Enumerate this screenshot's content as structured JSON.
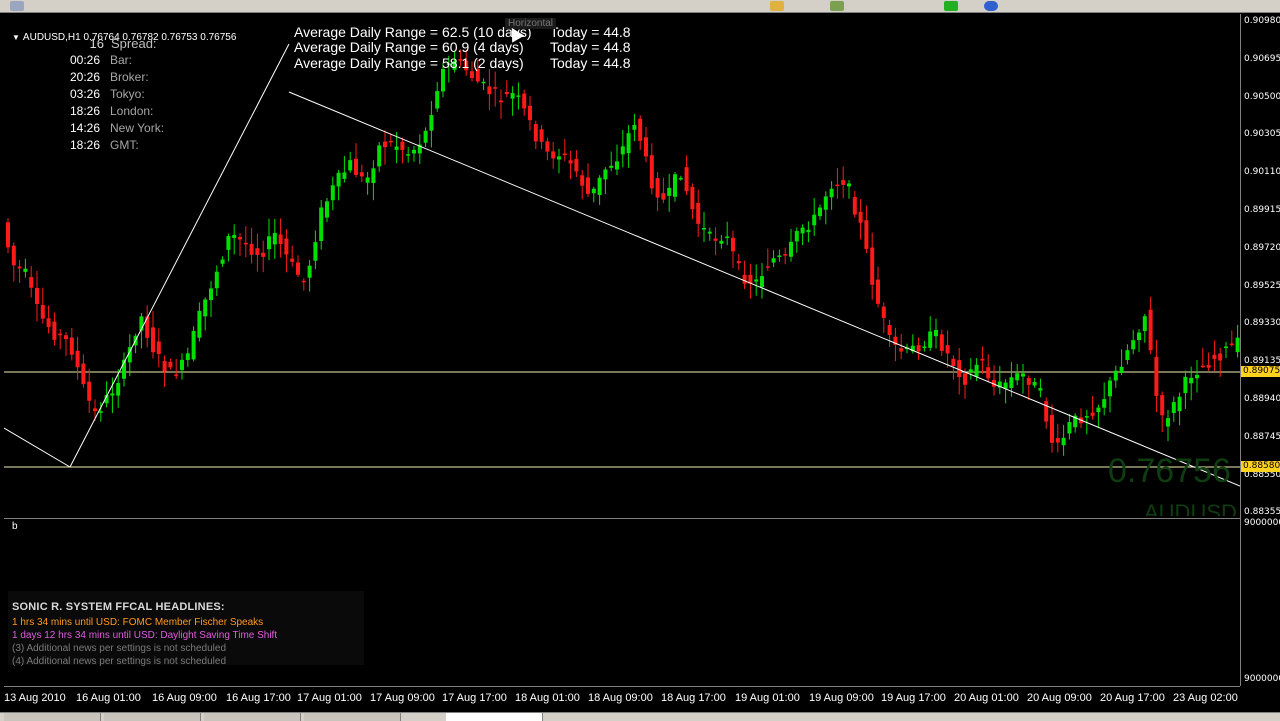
{
  "chart": {
    "header": "AUDUSD,H1  0.76764 0.76782 0.76753 0.76756",
    "spread_value": "16",
    "spread_label": "Spread:",
    "sessions": [
      {
        "time": "00:26",
        "name": "Bar:"
      },
      {
        "time": "20:26",
        "name": "Broker:"
      },
      {
        "time": "03:26",
        "name": "Tokyo:"
      },
      {
        "time": "18:26",
        "name": "London:"
      },
      {
        "time": "14:26",
        "name": "New York:"
      },
      {
        "time": "18:26",
        "name": "GMT:"
      }
    ],
    "adr": [
      {
        "label": "Average Daily Range = 62.5 (10 days)",
        "today": "Today = 44.8"
      },
      {
        "label": "Average Daily Range = 60.9 (4 days)",
        "today": "Today = 44.8"
      },
      {
        "label": "Average Daily Range = 58.1 (2 days)",
        "today": "Today = 44.8"
      }
    ],
    "tooltip": "Horizontal",
    "watermark_price": "0.76756",
    "watermark_symbol": "AUDUSD"
  },
  "price_scale": {
    "labels": [
      "0.90980",
      "0.90695",
      "0.90500",
      "0.90305",
      "0.90110",
      "0.89915",
      "0.89720",
      "0.89525",
      "0.89330",
      "0.89135",
      "0.88940",
      "0.88745",
      "0.88550",
      "0.88355"
    ],
    "marker_upper": "0.89075",
    "marker_lower": "0.88580",
    "sub_top": "9000000",
    "sub_bottom": "9000000"
  },
  "time_axis": [
    "13 Aug 2010",
    "16 Aug 01:00",
    "16 Aug 09:00",
    "16 Aug 17:00",
    "17 Aug 01:00",
    "17 Aug 09:00",
    "17 Aug 17:00",
    "18 Aug 01:00",
    "18 Aug 09:00",
    "18 Aug 17:00",
    "19 Aug 01:00",
    "19 Aug 09:00",
    "19 Aug 17:00",
    "20 Aug 01:00",
    "20 Aug 09:00",
    "20 Aug 17:00",
    "23 Aug 02:00"
  ],
  "sub_window": {
    "label": "b",
    "news_title": "SONIC R. SYSTEM  FFCAL HEADLINES:",
    "news": [
      {
        "text": "1 hrs 34 mins until USD: FOMC Member Fischer Speaks",
        "color": "#ff9a1f"
      },
      {
        "text": "1 days 12 hrs 34 mins until USD: Daylight Saving Time Shift",
        "color": "#e05de0"
      },
      {
        "text": "(3)  Additional news per settings is not scheduled",
        "color": "#7a7a7a"
      },
      {
        "text": "(4)  Additional news per settings is not scheduled",
        "color": "#7a7a7a"
      }
    ]
  },
  "colors": {
    "bull": "#00e000",
    "bear": "#ff1a1a",
    "hline": "#f0f0b0",
    "trend": "#ffffff",
    "marker": "#ffd21f"
  }
}
